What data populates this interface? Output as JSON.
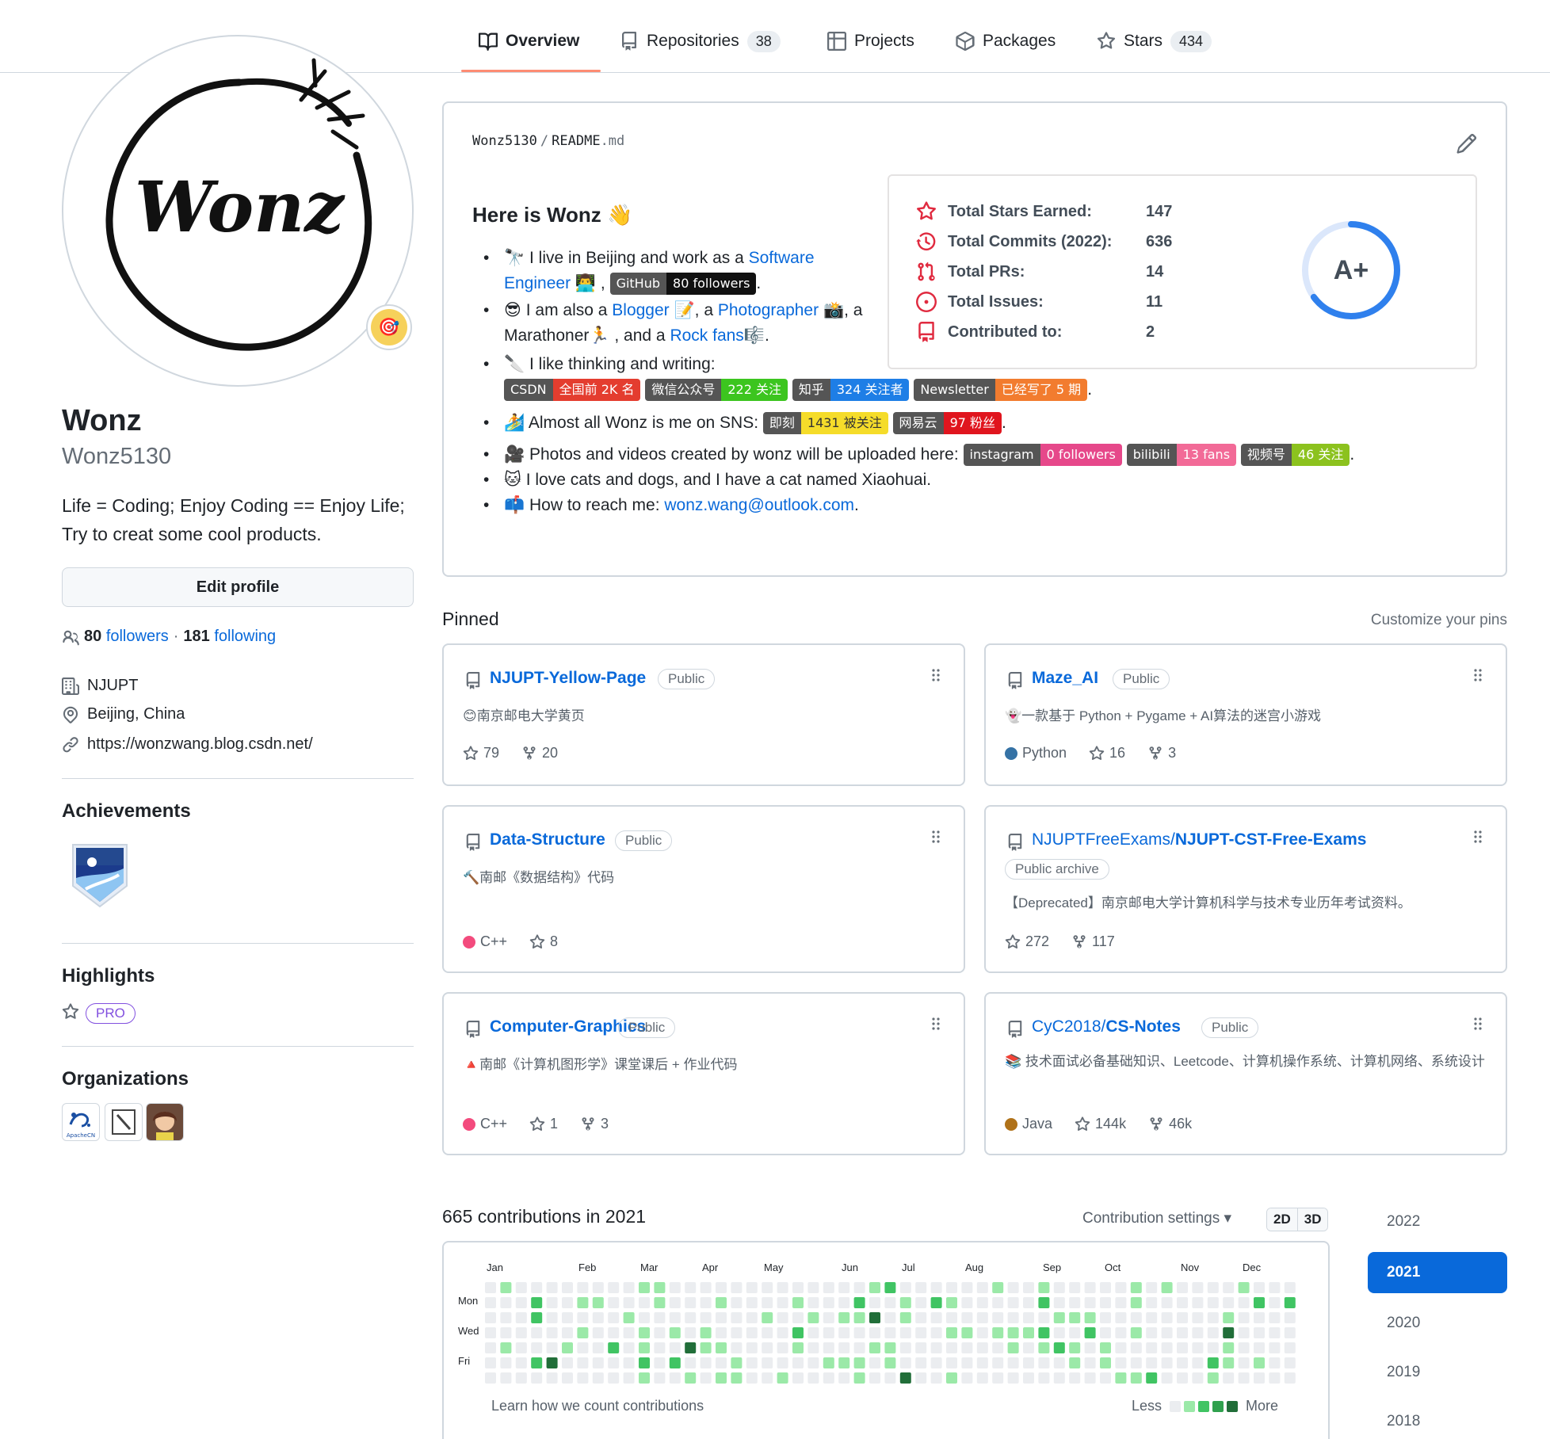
{
  "nav": {
    "tabs": [
      {
        "label": "Overview",
        "count": ""
      },
      {
        "label": "Repositories",
        "count": "38"
      },
      {
        "label": "Projects",
        "count": ""
      },
      {
        "label": "Packages",
        "count": ""
      },
      {
        "label": "Stars",
        "count": "434"
      }
    ]
  },
  "profile": {
    "avatar_text": "Wonz",
    "status_emoji": "🎯",
    "name": "Wonz",
    "login": "Wonz5130",
    "bio": "Life = Coding; Enjoy Coding == Enjoy Life; Try to creat some cool products.",
    "edit_label": "Edit profile",
    "followers": "80",
    "followers_label": "followers",
    "sep": "·",
    "following": "181",
    "following_label": "following",
    "company": "NJUPT",
    "location": "Beijing, China",
    "website": "https://wonzwang.blog.csdn.net/"
  },
  "sidebar": {
    "achievements_h": "Achievements",
    "highlights_h": "Highlights",
    "pro_label": "PRO",
    "organizations_h": "Organizations",
    "org1_text": "ApacheCN"
  },
  "readme": {
    "owner": "Wonz5130",
    "sep": "/",
    "file": "README",
    "ext": ".md",
    "heading": "Here is Wonz 👋",
    "b1": {
      "pre": "🔭 I live in Beijing and work as a ",
      "link": "Software Engineer",
      "post": " 👨‍💻 ,",
      "end": "."
    },
    "b2": {
      "p1": "😎 I am also a ",
      "l1": "Blogger",
      "p2": " 📝, a ",
      "l2": "Photographer",
      "p3": " 📸, a Marathoner🏃 , and a ",
      "l3": "Rock fans",
      "p4": "🎼."
    },
    "b3": {
      "text": "🔪 I like thinking and writing:",
      "end": "."
    },
    "b4": {
      "text": "🏄 Almost all Wonz is me on SNS: ",
      "end": "."
    },
    "b5": {
      "text": "🎥 Photos and videos created by wonz will be uploaded here: ",
      "end": "."
    },
    "b6": {
      "text": "🐱 I love cats and dogs, and I have a cat named Xiaohuai."
    },
    "b7": {
      "text": "📫 How to reach me: ",
      "link": "wonz.wang@outlook.com",
      "end": "."
    },
    "shields": {
      "github": {
        "l": "GitHub",
        "r": "80 followers"
      },
      "csdn": {
        "l": "CSDN",
        "r": "全国前 2K 名"
      },
      "wechat": {
        "l": "微信公众号",
        "r": "222 关注"
      },
      "zhihu": {
        "l": "知乎",
        "r": "324 关注者"
      },
      "newsletter": {
        "l": "Newsletter",
        "r": "已经写了 5 期"
      },
      "jike": {
        "l": "即刻",
        "r": "1431 被关注"
      },
      "netease": {
        "l": "网易云",
        "r": "97 粉丝"
      },
      "instagram": {
        "l": "instagram",
        "r": "0 followers"
      },
      "bilibili": {
        "l": "bilibili",
        "r": "13 fans"
      },
      "channels": {
        "l": "视频号",
        "r": "46 关注"
      }
    },
    "stats": {
      "rows": [
        {
          "label": "Total Stars Earned:",
          "value": "147"
        },
        {
          "label": "Total Commits (2022):",
          "value": "636"
        },
        {
          "label": "Total PRs:",
          "value": "14"
        },
        {
          "label": "Total Issues:",
          "value": "11"
        },
        {
          "label": "Contributed to:",
          "value": "2"
        }
      ],
      "grade": "A+",
      "grade_fraction": 0.65
    }
  },
  "pinned": {
    "heading": "Pinned",
    "customize": "Customize your pins",
    "public": "Public",
    "public_archive": "Public archive",
    "cards": [
      {
        "owner": "",
        "name": "NJUPT-Yellow-Page",
        "desc": "😊南京邮电大学黄页",
        "lang": "",
        "lang_color": "",
        "stars": "79",
        "forks": "20"
      },
      {
        "owner": "",
        "name": "Maze_AI",
        "desc": "👻一款基于 Python + Pygame + AI算法的迷宫小游戏",
        "lang": "Python",
        "lang_color": "#3572A5",
        "stars": "16",
        "forks": "3"
      },
      {
        "owner": "",
        "name": "Data-Structure",
        "desc": "🔨南邮《数据结构》代码",
        "lang": "C++",
        "lang_color": "#f34b7d",
        "stars": "8",
        "forks": ""
      },
      {
        "owner": "NJUPTFreeExams/",
        "name": "NJUPT-CST-Free-Exams",
        "desc": "【Deprecated】南京邮电大学计算机科学与技术专业历年考试资料。",
        "lang": "",
        "lang_color": "",
        "stars": "272",
        "forks": "117"
      },
      {
        "owner": "",
        "name": "Computer-Graphics",
        "desc": "🔺南邮《计算机图形学》课堂课后 + 作业代码",
        "lang": "C++",
        "lang_color": "#f34b7d",
        "stars": "1",
        "forks": "3"
      },
      {
        "owner": "CyC2018/",
        "name": "CS-Notes",
        "desc": "📚 技术面试必备基础知识、Leetcode、计算机操作系统、计算机网络、系统设计",
        "lang": "Java",
        "lang_color": "#b07219",
        "stars": "144k",
        "forks": "46k"
      }
    ]
  },
  "contrib": {
    "heading": "665 contributions in 2021",
    "settings": "Contribution settings ▾",
    "view_2d": "2D",
    "view_3d": "3D",
    "months": [
      "Jan",
      "Feb",
      "Mar",
      "Apr",
      "May",
      "Jun",
      "Jul",
      "Aug",
      "Sep",
      "Oct",
      "Nov",
      "Dec"
    ],
    "days": [
      "Mon",
      "Wed",
      "Fri"
    ],
    "learn": "Learn how we count contributions",
    "less": "Less",
    "more": "More",
    "colors": [
      "#ebedf0",
      "#9be9a8",
      "#40c463",
      "#30a14e",
      "#216e39"
    ],
    "years": [
      "2022",
      "2021",
      "2020",
      "2019",
      "2018"
    ]
  }
}
